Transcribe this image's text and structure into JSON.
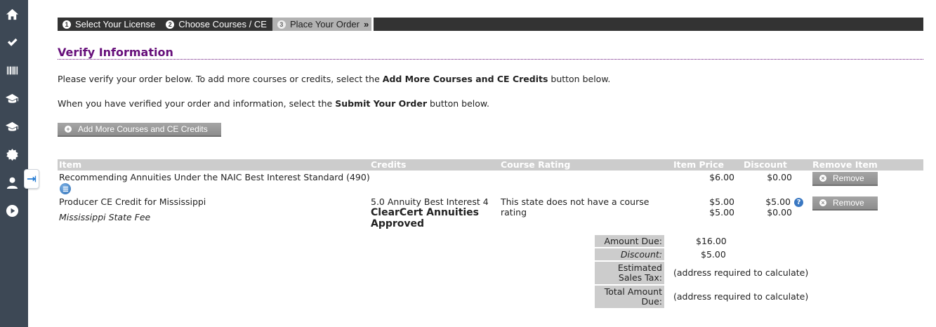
{
  "sidebar": {
    "icons": [
      "home-icon",
      "check-icon",
      "barcode-icon",
      "graduation-cap-icon",
      "graduation-cap-icon",
      "badge-icon",
      "user-icon",
      "play-icon"
    ],
    "expand_icon": "arrow-right-icon"
  },
  "steps": [
    {
      "num": "1",
      "label": "Select Your License"
    },
    {
      "num": "2",
      "label": "Choose Courses / CE"
    },
    {
      "num": "3",
      "label": "Place Your Order",
      "chevron": "»"
    }
  ],
  "page_title": "Verify Information",
  "intro": {
    "line1_pre": "Please verify your order below. To add more courses or credits, select the ",
    "line1_bold": "Add More Courses and CE Credits",
    "line1_post": " button below.",
    "line2_pre": "When you have verified your order and information, select the ",
    "line2_bold": "Submit Your Order",
    "line2_post": " button below."
  },
  "add_button_label": "Add More Courses and CE Credits",
  "table": {
    "headers": {
      "item": "Item",
      "credits": "Credits",
      "rating": "Course Rating",
      "price": "Item Price",
      "discount": "Discount",
      "remove": "Remove Item"
    },
    "rows": [
      {
        "item": "Recommending Annuities Under the NAIC Best Interest Standard (490)",
        "price": "$6.00",
        "discount": "$0.00",
        "remove_label": "Remove"
      },
      {
        "item": "Producer CE Credit for Mississippi",
        "sub_item": "Mississippi State Fee",
        "credits_line": "5.0 Annuity Best Interest 4",
        "credits_bold1": "ClearCert Annuities",
        "credits_bold2": "Approved",
        "rating_line1": "This state does not have a course",
        "rating_line2": "rating",
        "price": "$5.00",
        "sub_price": "$5.00",
        "discount": "$5.00",
        "sub_discount": "$0.00",
        "remove_label": "Remove"
      }
    ]
  },
  "summary": {
    "amount_due_label": "Amount Due:",
    "amount_due": "$16.00",
    "discount_label": "Discount:",
    "discount": "$5.00",
    "tax_label_1": "Estimated",
    "tax_label_2": "Sales Tax:",
    "tax_value": "(address required to calculate)",
    "total_label_1": "Total Amount",
    "total_label_2": "Due:",
    "total_value": "(address required to calculate)"
  }
}
